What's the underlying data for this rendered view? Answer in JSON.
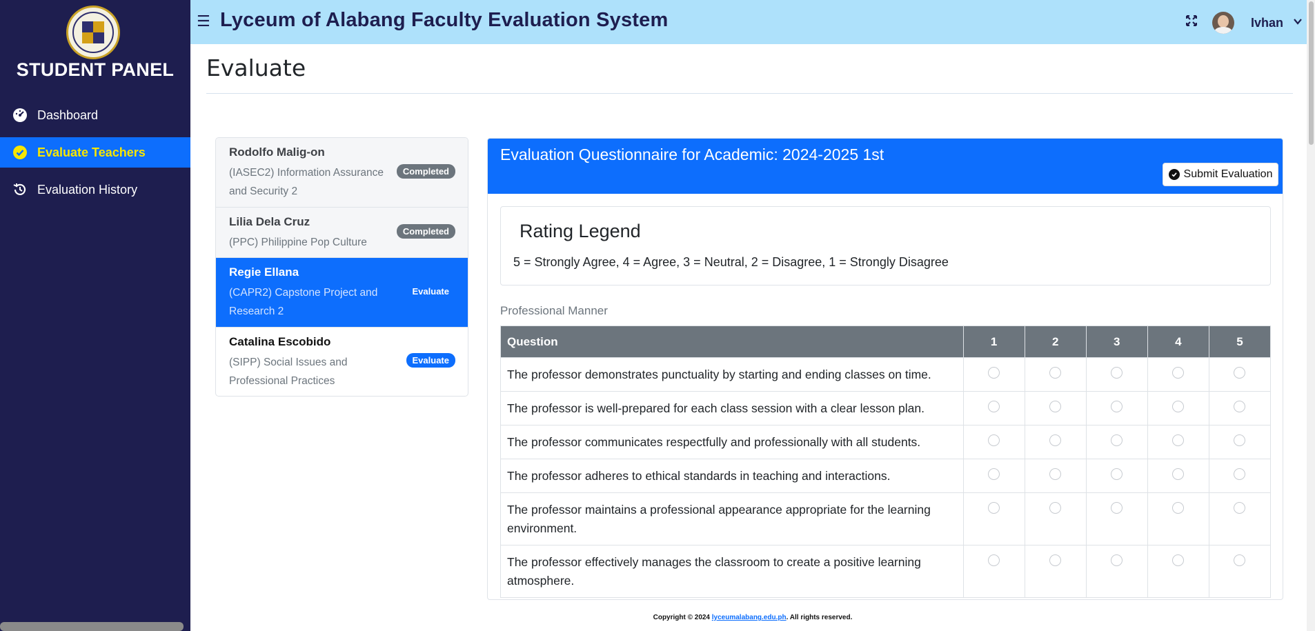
{
  "sidebar": {
    "panel_title": "STUDENT PANEL",
    "items": [
      {
        "label": "Dashboard",
        "icon": "gauge-icon"
      },
      {
        "label": "Evaluate Teachers",
        "icon": "check-circle-icon",
        "active": true
      },
      {
        "label": "Evaluation History",
        "icon": "history-icon"
      }
    ]
  },
  "header": {
    "title": "Lyceum of Alabang Faculty Evaluation System",
    "user_name": "Ivhan"
  },
  "page": {
    "title": "Evaluate"
  },
  "teachers": [
    {
      "name": "Rodolfo Malig-on",
      "course": "(IASEC2) Information Assurance and Security 2",
      "status": "Completed"
    },
    {
      "name": "Lilia Dela Cruz",
      "course": "(PPC) Philippine Pop Culture",
      "status": "Completed"
    },
    {
      "name": "Regie Ellana",
      "course": "(CAPR2) Capstone Project and Research 2",
      "status": "Evaluate"
    },
    {
      "name": "Catalina Escobido",
      "course": "(SIPP) Social Issues and Professional Practices",
      "status": "Evaluate"
    }
  ],
  "questionnaire": {
    "title": "Evaluation Questionnaire for Academic: 2024-2025 1st",
    "submit_label": "Submit Evaluation",
    "legend_title": "Rating Legend",
    "legend_text": "5 = Strongly Agree, 4 = Agree, 3 = Neutral, 2 = Disagree, 1 = Strongly Disagree",
    "section": "Professional Manner",
    "columns": [
      "Question",
      "1",
      "2",
      "3",
      "4",
      "5"
    ],
    "questions": [
      "The professor demonstrates punctuality by starting and ending classes on time.",
      "The professor is well-prepared for each class session with a clear lesson plan.",
      "The professor communicates respectfully and professionally with all students.",
      "The professor adheres to ethical standards in teaching and interactions.",
      "The professor maintains a professional appearance appropriate for the learning environment.",
      "The professor effectively manages the classroom to create a positive learning atmosphere."
    ]
  },
  "footer": {
    "prefix": "Copyright © 2024 ",
    "link": "lyceumalabang.edu.ph",
    "suffix": ". All rights reserved."
  },
  "colors": {
    "sidebar_bg": "#1e1e4f",
    "header_bg": "#aee1fb",
    "primary": "#0d6efd",
    "active_text": "#f7e600",
    "table_head": "#6c757d"
  }
}
